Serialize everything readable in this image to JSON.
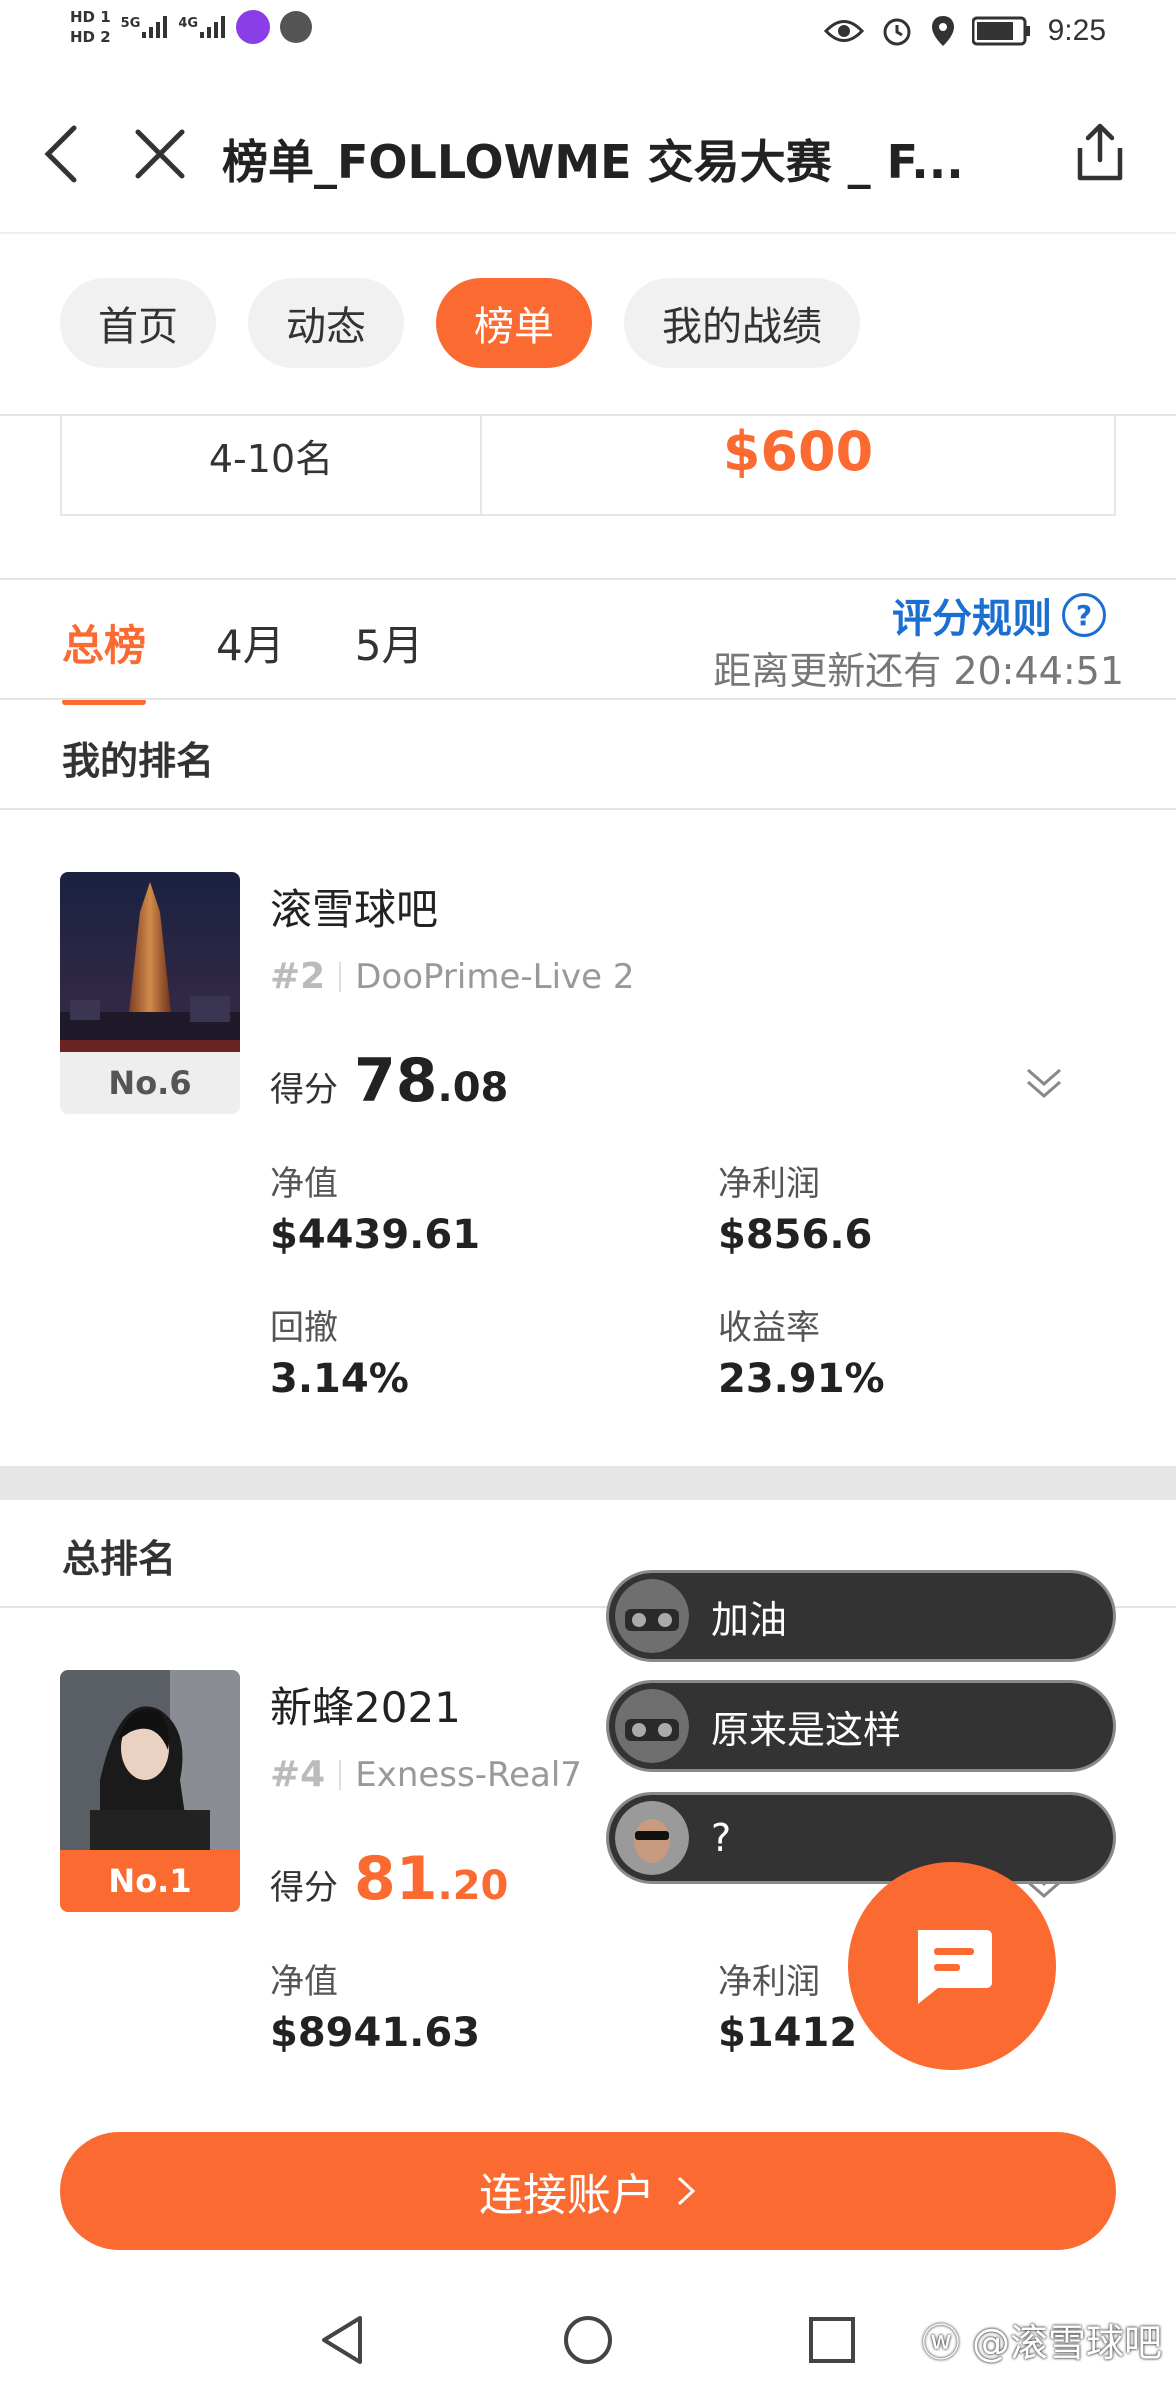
{
  "status_bar": {
    "hd1": "HD 1",
    "hd2": "HD 2",
    "net1": "5G",
    "net2": "4G",
    "time": "9:25"
  },
  "header": {
    "title": "榜单_FOLLOWME 交易大赛 _ F..."
  },
  "tabs": [
    {
      "label": "首页"
    },
    {
      "label": "动态"
    },
    {
      "label": "榜单",
      "active": true
    },
    {
      "label": "我的战绩"
    }
  ],
  "prize": {
    "rank": "4-10名",
    "amount": "$600"
  },
  "subtabs": [
    {
      "label": "总榜",
      "active": true
    },
    {
      "label": "4月"
    },
    {
      "label": "5月"
    }
  ],
  "rules_label": "评分规则",
  "countdown": "距离更新还有 20:44:51",
  "my_rank": {
    "section_title": "我的排名",
    "name": "滚雪球吧",
    "rank_num": "#2",
    "server": "DooPrime-Live 2",
    "badge": "No.6",
    "score_label": "得分",
    "score_int": "78",
    "score_dec": ".08",
    "stats": [
      {
        "label": "净值",
        "value": "$4439.61"
      },
      {
        "label": "净利润",
        "value": "$856.6"
      },
      {
        "label": "回撤",
        "value": "3.14%"
      },
      {
        "label": "收益率",
        "value": "23.91%"
      }
    ]
  },
  "overall": {
    "section_title": "总排名",
    "name": "新蜂2021",
    "rank_num": "#4",
    "server": "Exness-Real7",
    "badge": "No.1",
    "score_label": "得分",
    "score_int": "81",
    "score_dec": ".20",
    "stats": [
      {
        "label": "净值",
        "value": "$8941.63"
      },
      {
        "label": "净利润",
        "value": "$1412"
      }
    ]
  },
  "comments": [
    {
      "text": "加油"
    },
    {
      "text": "原来是这样"
    },
    {
      "text": "?"
    }
  ],
  "connect_button": "连接账户",
  "watermark": "@滚雪球吧",
  "colors": {
    "accent": "#fb6a30",
    "link": "#1a6fd0"
  }
}
